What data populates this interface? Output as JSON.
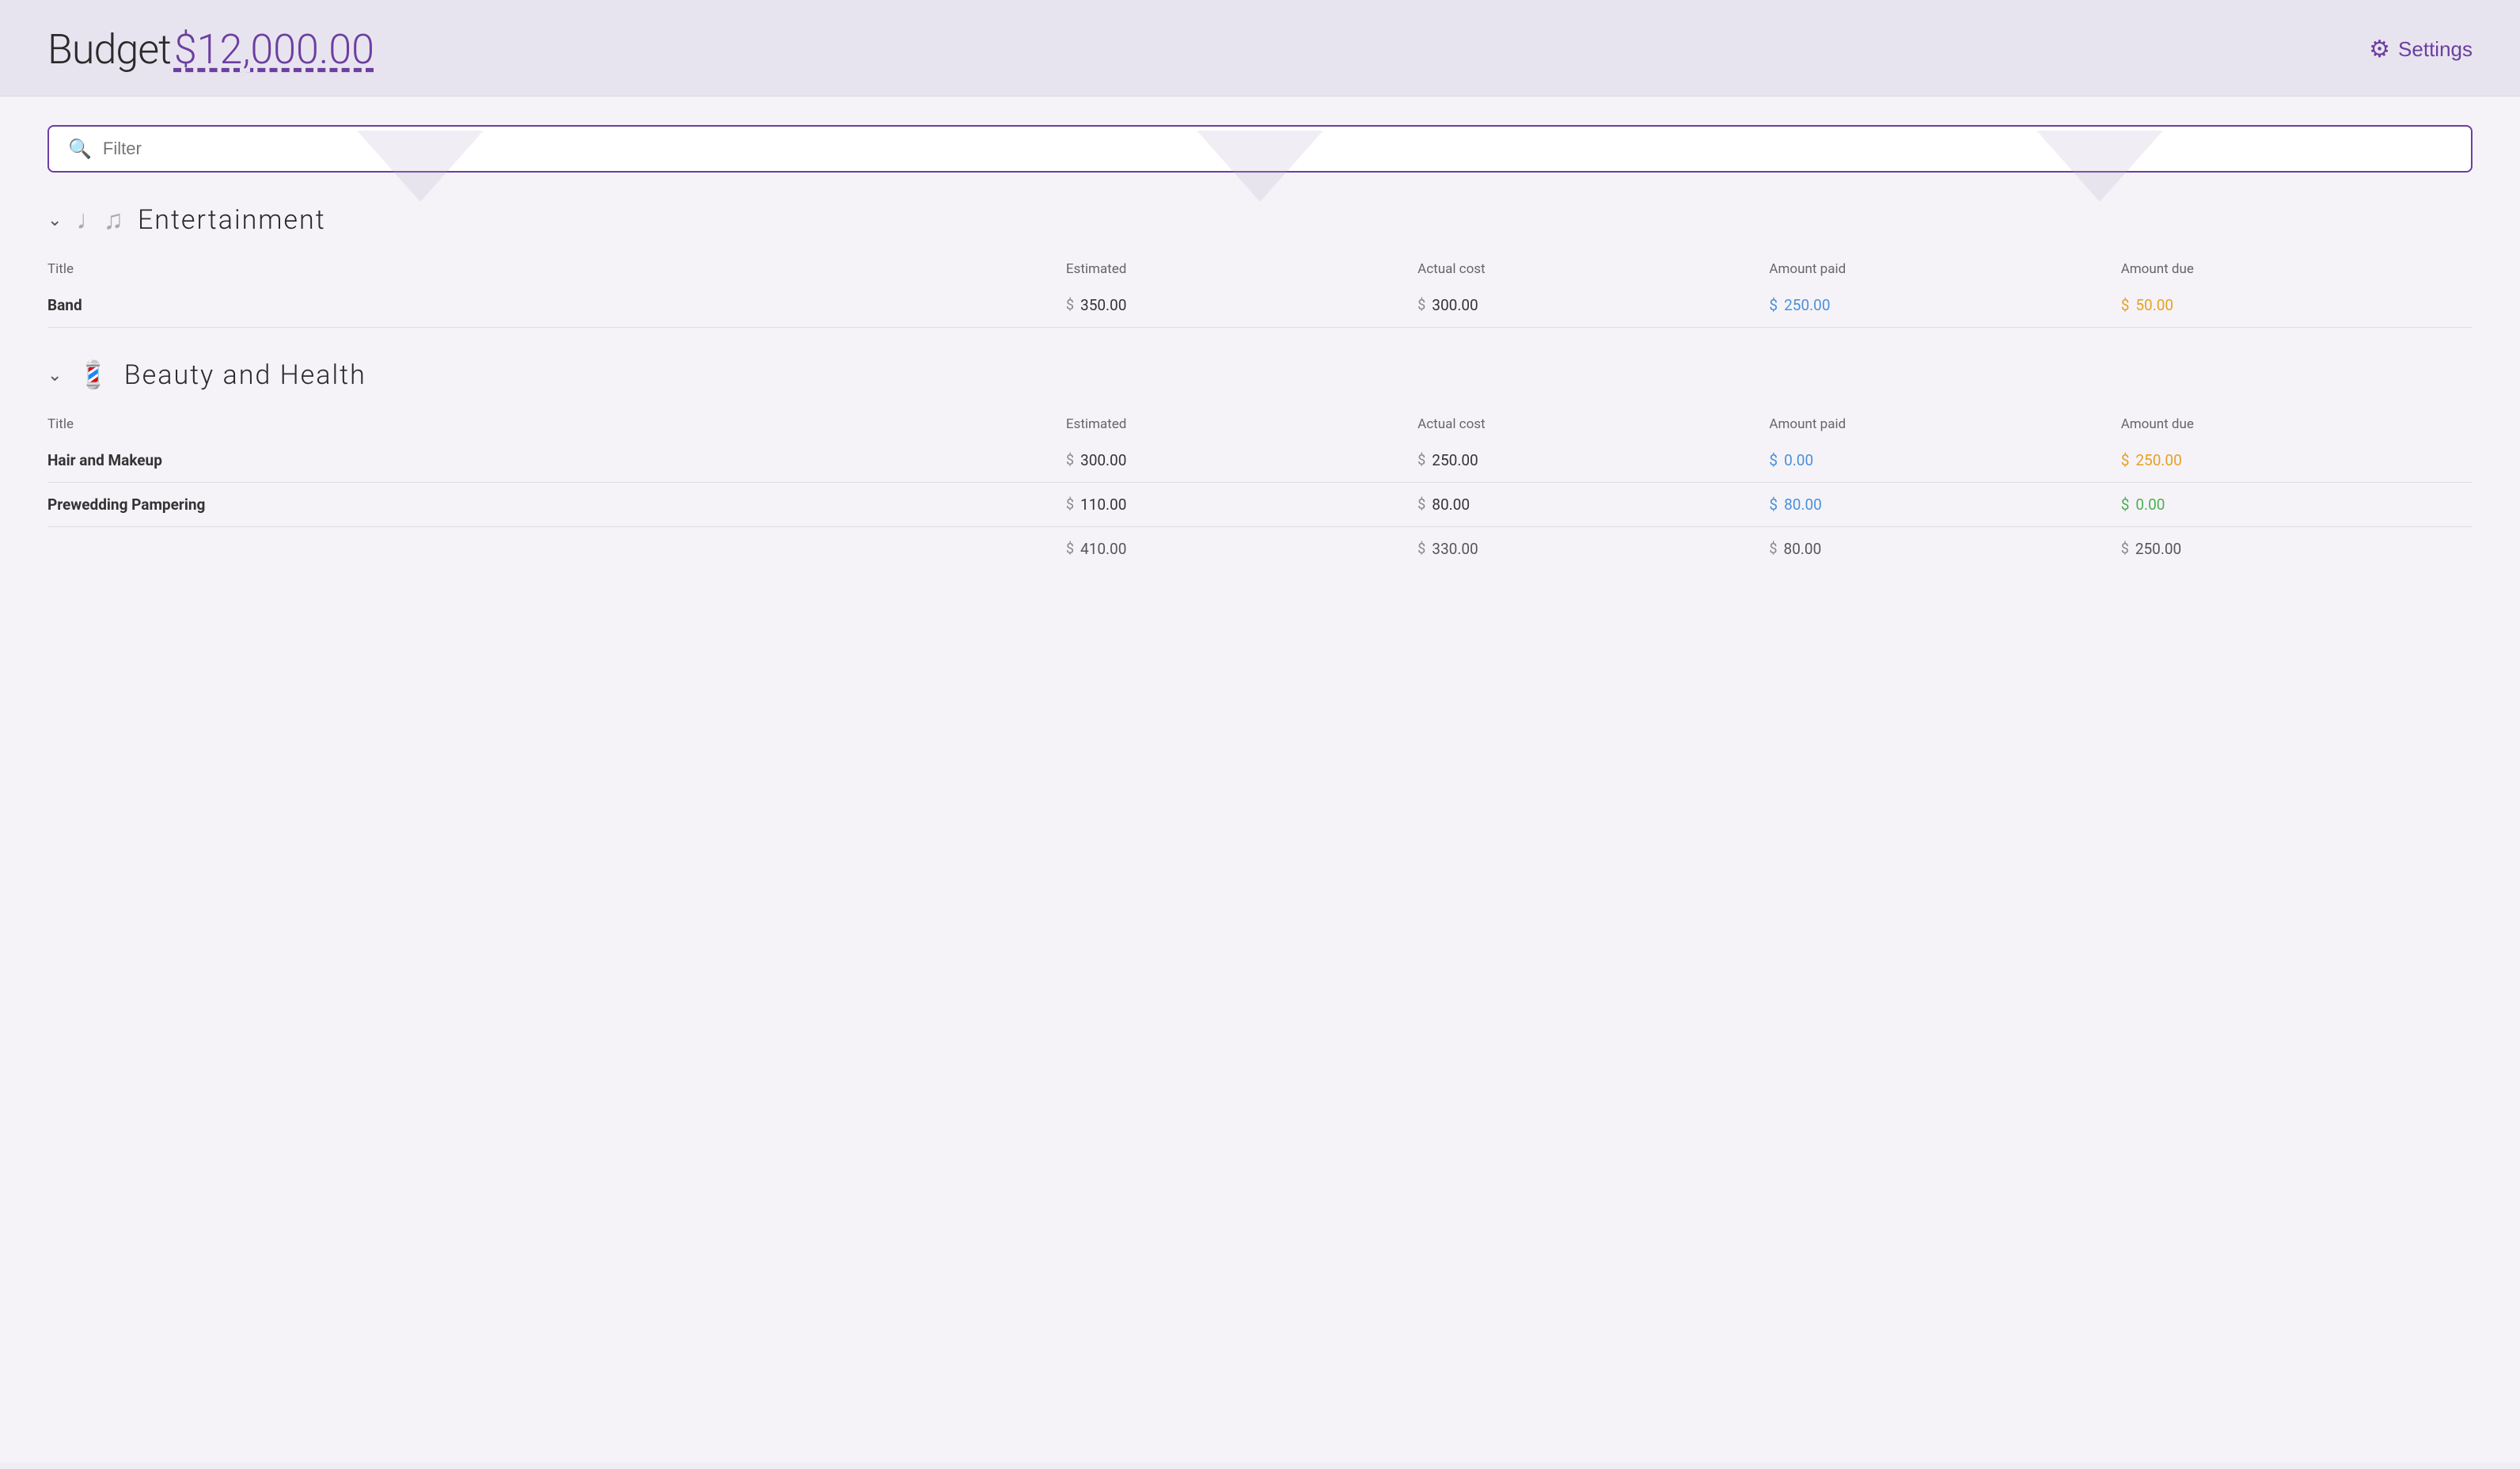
{
  "header": {
    "budget_label": "Budget",
    "budget_amount": "$12,000.00",
    "settings_label": "Settings"
  },
  "filter": {
    "placeholder": "Filter"
  },
  "sections": [
    {
      "id": "entertainment",
      "icon": "♩♫",
      "title": "Entertainment",
      "columns": {
        "title": "Title",
        "estimated": "Estimated",
        "actual_cost": "Actual cost",
        "amount_paid": "Amount paid",
        "amount_due": "Amount due"
      },
      "rows": [
        {
          "title": "Band",
          "estimated": "350.00",
          "actual_cost": "300.00",
          "amount_paid": "250.00",
          "amount_due": "50.00",
          "paid_color": "blue",
          "due_color": "orange"
        }
      ],
      "footer": null
    },
    {
      "id": "beauty-health",
      "icon": "💇",
      "title": "Beauty and Health",
      "columns": {
        "title": "Title",
        "estimated": "Estimated",
        "actual_cost": "Actual cost",
        "amount_paid": "Amount paid",
        "amount_due": "Amount due"
      },
      "rows": [
        {
          "title": "Hair and Makeup",
          "estimated": "300.00",
          "actual_cost": "250.00",
          "amount_paid": "0.00",
          "amount_due": "250.00",
          "paid_color": "blue",
          "due_color": "orange"
        },
        {
          "title": "Prewedding Pampering",
          "estimated": "110.00",
          "actual_cost": "80.00",
          "amount_paid": "80.00",
          "amount_due": "0.00",
          "paid_color": "blue",
          "due_color": "green"
        }
      ],
      "footer": {
        "estimated": "410.00",
        "actual_cost": "330.00",
        "amount_paid": "80.00",
        "amount_due": "250.00"
      }
    }
  ]
}
